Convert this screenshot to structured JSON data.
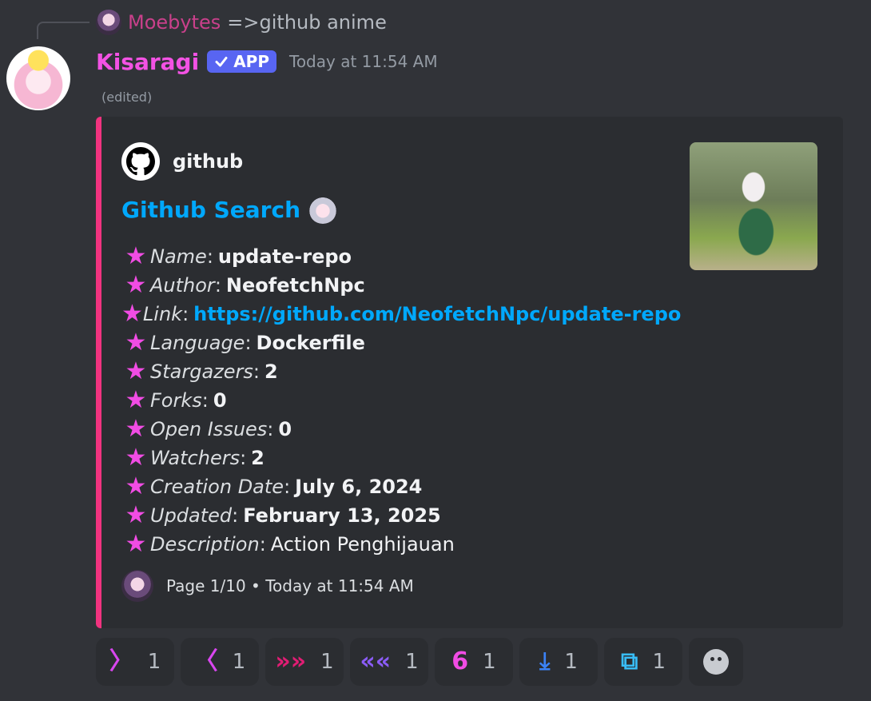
{
  "reply": {
    "username": "Moebytes",
    "text": "=>github anime"
  },
  "message": {
    "username": "Kisaragi",
    "app_badge": "APP",
    "timestamp": "Today at 11:54 AM",
    "edited": "(edited)"
  },
  "embed": {
    "accent_color": "#f1337f",
    "author": "github",
    "title": "Github Search",
    "fields": [
      {
        "label": "Name",
        "value": "update-repo",
        "style": "bold"
      },
      {
        "label": "Author",
        "value": "NeofetchNpc",
        "style": "bold"
      },
      {
        "label": "Link",
        "value": "https://github.com/NeofetchNpc/update-repo",
        "style": "link"
      },
      {
        "label": "Language",
        "value": "Dockerfile",
        "style": "bold"
      },
      {
        "label": "Stargazers",
        "value": "2",
        "style": "bold"
      },
      {
        "label": "Forks",
        "value": "0",
        "style": "bold"
      },
      {
        "label": "Open Issues",
        "value": "0",
        "style": "bold"
      },
      {
        "label": "Watchers",
        "value": "2",
        "style": "bold"
      },
      {
        "label": "Creation Date",
        "value": "July 6, 2024",
        "style": "bold"
      },
      {
        "label": "Updated",
        "value": "February 13, 2025",
        "style": "bold"
      },
      {
        "label": "Description",
        "value": "Action Penghijauan",
        "style": "plain"
      }
    ],
    "footer": "Page 1/10 • Today at 11:54 AM"
  },
  "reactions": [
    {
      "emoji": "〉",
      "name": "right-arrow",
      "color": "#d946ef",
      "count": "1"
    },
    {
      "emoji": "〈",
      "name": "left-arrow",
      "color": "#d946ef",
      "count": "1"
    },
    {
      "emoji": "»»",
      "name": "fast-forward",
      "color": "#e11d74",
      "count": "1"
    },
    {
      "emoji": "««",
      "name": "rewind",
      "color": "#8b5cf6",
      "count": "1"
    },
    {
      "emoji": "6",
      "name": "number-six",
      "color": "#f14ce4",
      "count": "1"
    },
    {
      "emoji": "⤓",
      "name": "download",
      "color": "#3b82f6",
      "count": "1"
    },
    {
      "emoji": "⧉",
      "name": "repost",
      "color": "#38bdf8",
      "count": "1"
    }
  ]
}
